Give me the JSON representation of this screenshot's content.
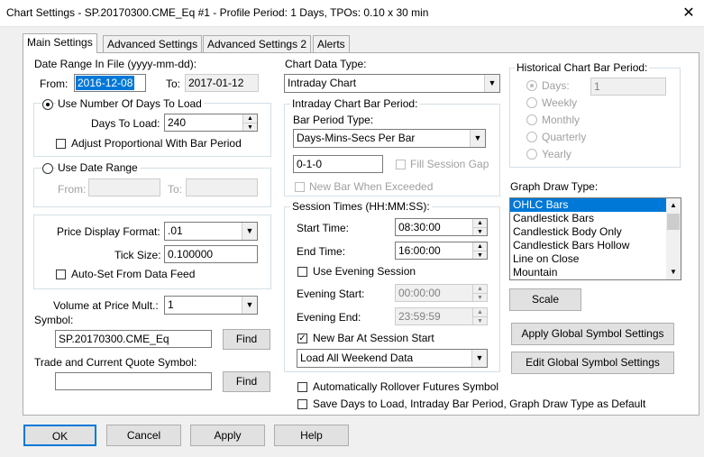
{
  "window": {
    "title": "Chart Settings - SP.20170300.CME_Eq  #1 - Profile Period: 1 Days, TPOs: 0.10 x 30 min",
    "close_glyph": "✕"
  },
  "tabs": [
    {
      "label": "Main Settings"
    },
    {
      "label": "Advanced Settings"
    },
    {
      "label": "Advanced Settings 2"
    },
    {
      "label": "Alerts"
    }
  ],
  "date_range": {
    "heading": "Date Range In File (yyyy-mm-dd):",
    "from_label": "From:",
    "from_value": "2016-12-08",
    "to_label": "To:",
    "to_value": "2017-01-12"
  },
  "days_group": {
    "radio_label": "Use Number Of Days To Load",
    "days_label": "Days To Load:",
    "days_value": "240",
    "adjust_label": "Adjust Proportional With Bar Period"
  },
  "date_range_group": {
    "radio_label": "Use Date Range",
    "from_label": "From:",
    "to_label": "To:"
  },
  "price_group": {
    "format_label": "Price Display Format:",
    "format_value": ".01",
    "tick_label": "Tick Size:",
    "tick_value": "0.100000",
    "autoset_label": "Auto-Set From Data Feed"
  },
  "volume": {
    "label": "Volume at Price Mult.:",
    "value": "1"
  },
  "symbol": {
    "label": "Symbol:",
    "value": "SP.20170300.CME_Eq",
    "find_label": "Find"
  },
  "trade_symbol": {
    "label": "Trade and Current Quote Symbol:",
    "value": "",
    "find_label": "Find"
  },
  "chart_data_type": {
    "label": "Chart Data Type:",
    "value": "Intraday Chart"
  },
  "intraday_group": {
    "heading": "Intraday Chart Bar Period:",
    "type_label": "Bar Period Type:",
    "type_value": "Days-Mins-Secs Per Bar",
    "period_value": "0-1-0",
    "fill_gap_label": "Fill Session Gap",
    "new_bar_label": "New Bar When Exceeded"
  },
  "session_group": {
    "heading": "Session Times (HH:MM:SS):",
    "start_label": "Start Time:",
    "start_value": "08:30:00",
    "end_label": "End Time:",
    "end_value": "16:00:00",
    "evening_label": "Use Evening Session",
    "evening_start_label": "Evening Start:",
    "evening_start_value": "00:00:00",
    "evening_end_label": "Evening End:",
    "evening_end_value": "23:59:59",
    "new_bar_session_label": "New Bar At Session Start",
    "weekend_value": "Load All Weekend Data"
  },
  "rollover_label": "Automatically Rollover Futures Symbol",
  "save_default_label": "Save Days to Load, Intraday Bar Period, Graph Draw Type as Default",
  "historical_group": {
    "heading": "Historical Chart Bar Period:",
    "options": [
      "Days:",
      "Weekly",
      "Monthly",
      "Quarterly",
      "Yearly"
    ],
    "days_value": "1"
  },
  "graph_draw": {
    "label": "Graph Draw Type:",
    "items": [
      "OHLC Bars",
      "Candlestick Bars",
      "Candlestick Body Only",
      "Candlestick Bars Hollow",
      "Line on Close",
      "Mountain"
    ],
    "selected": "OHLC Bars"
  },
  "scale_label": "Scale",
  "apply_global_label": "Apply Global Symbol Settings",
  "edit_global_label": "Edit Global Symbol Settings",
  "footer": {
    "ok": "OK",
    "cancel": "Cancel",
    "apply": "Apply",
    "help": "Help"
  },
  "glyphs": {
    "check": "✓",
    "down": "▼",
    "up": "▲"
  },
  "colors": {
    "selection": "#0078d7",
    "window_bg": "#f0f0f0",
    "panel_bg": "#ffffff"
  }
}
